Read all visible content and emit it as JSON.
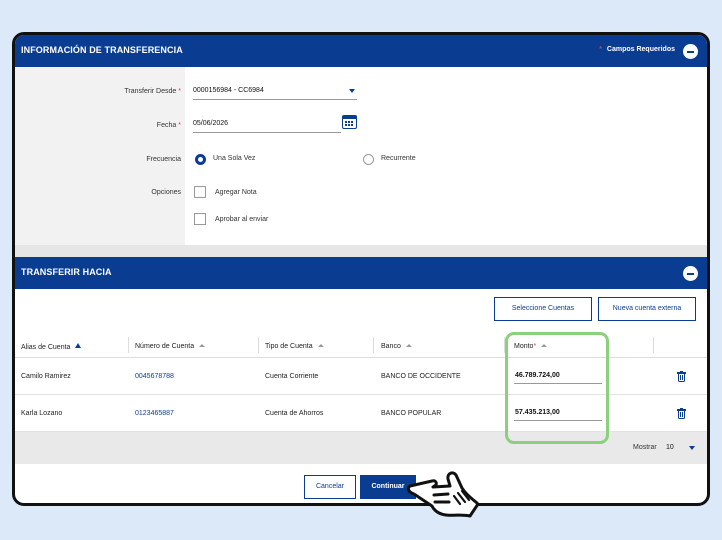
{
  "transfer_info": {
    "title": "INFORMACIÓN DE TRANSFERENCIA",
    "required_star": "*",
    "required_label": "Campos Requeridos",
    "from_label": "Transferir Desde",
    "from_value": "0000156984 - CC6984",
    "date_label": "Fecha",
    "date_value": "05/06/2026",
    "frequency_label": "Frecuencia",
    "frequency_options": [
      "Una Sola Vez",
      "Recurrente"
    ],
    "frequency_selected": "Una Sola Vez",
    "options_label": "Opciones",
    "option_items": [
      "Agregar Nota",
      "Aprobar al enviar"
    ]
  },
  "transfer_to": {
    "title": "TRANSFERIR HACIA",
    "select_accounts_label": "Seleccione Cuentas",
    "new_external_label": "Nueva cuenta externa",
    "columns": [
      "Alias de Cuenta",
      "Número de Cuenta",
      "Tipo de Cuenta",
      "Banco",
      "Monto"
    ],
    "rows": [
      {
        "alias": "Camilo Ramirez",
        "account": "0045678788",
        "type": "Cuenta Corriente",
        "bank": "BANCO DE OCCIDENTE",
        "amount": "46.789.724,00"
      },
      {
        "alias": "Karla Lozano",
        "account": "0123465887",
        "type": "Cuenta de Ahorros",
        "bank": "BANCO POPULAR",
        "amount": "57.435.213,00"
      }
    ],
    "show_label": "Mostrar",
    "show_value": "10"
  },
  "actions": {
    "cancel_label": "Cancelar",
    "continue_label": "Continuar"
  },
  "colors": {
    "brand_blue": "#0a3d91",
    "required_red": "#e23b3b",
    "highlight_green": "#8bd07c",
    "page_background": "#dce9f8"
  },
  "icons": [
    "collapse-icon",
    "dropdown-caret-icon",
    "calendar-icon",
    "sort-arrow-icon",
    "trash-icon",
    "pointing-hand-cursor-icon"
  ]
}
